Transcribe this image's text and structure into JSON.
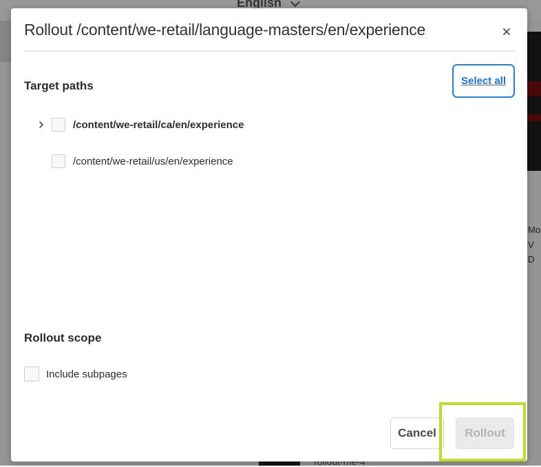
{
  "background": {
    "language_label": "English",
    "bottom_item_label": "rollout-me-4",
    "side_text": [
      "Mo",
      "V",
      "D"
    ]
  },
  "dialog": {
    "title": "Rollout /content/we-retail/language-masters/en/experience",
    "close_icon": "close-icon",
    "target_paths": {
      "heading": "Target paths",
      "select_all_label": "Select all",
      "paths": [
        {
          "label": "/content/we-retail/ca/en/experience",
          "expandable": true,
          "checked": false
        },
        {
          "label": "/content/we-retail/us/en/experience",
          "expandable": false,
          "checked": false
        }
      ]
    },
    "rollout_scope": {
      "heading": "Rollout scope",
      "include_subpages_label": "Include subpages",
      "include_subpages_checked": false
    },
    "buttons": {
      "cancel_label": "Cancel",
      "rollout_label": "Rollout",
      "rollout_disabled": true
    }
  },
  "colors": {
    "accent": "#1473e6",
    "highlight": "#b7e128",
    "disabled_text": "#b3b3b3"
  }
}
